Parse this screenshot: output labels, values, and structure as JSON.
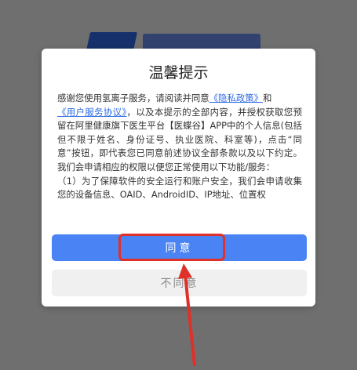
{
  "dialog": {
    "title": "温馨提示",
    "text_before_privacy": "感谢您使用氢离子服务，请阅读并同意",
    "privacy_link": "《隐私政策》",
    "text_and": "和",
    "terms_link": "《用户服务协议》",
    "text_rest": "，以及本提示的全部内容，并授权获取您预留在阿里健康旗下医生平台【医蝶谷】APP中的个人信息(包括但不限于姓名、身份证号、执业医院、科室等)，点击“同意”按钮，即代表您已同意前述协议全部条款以及以下约定。我们会申请相应的权限以便您正常使用以下功能/服务：",
    "text_item1": "（1）为了保障软件的安全运行和账户安全，我们会申请收集您的设备信息、OAID、AndroidID、IP地址、位置权",
    "agree_label": "同意",
    "disagree_label": "不同意"
  },
  "colors": {
    "accent": "#4a84f4",
    "link": "#2d6be5",
    "annotation": "#e0302a"
  }
}
